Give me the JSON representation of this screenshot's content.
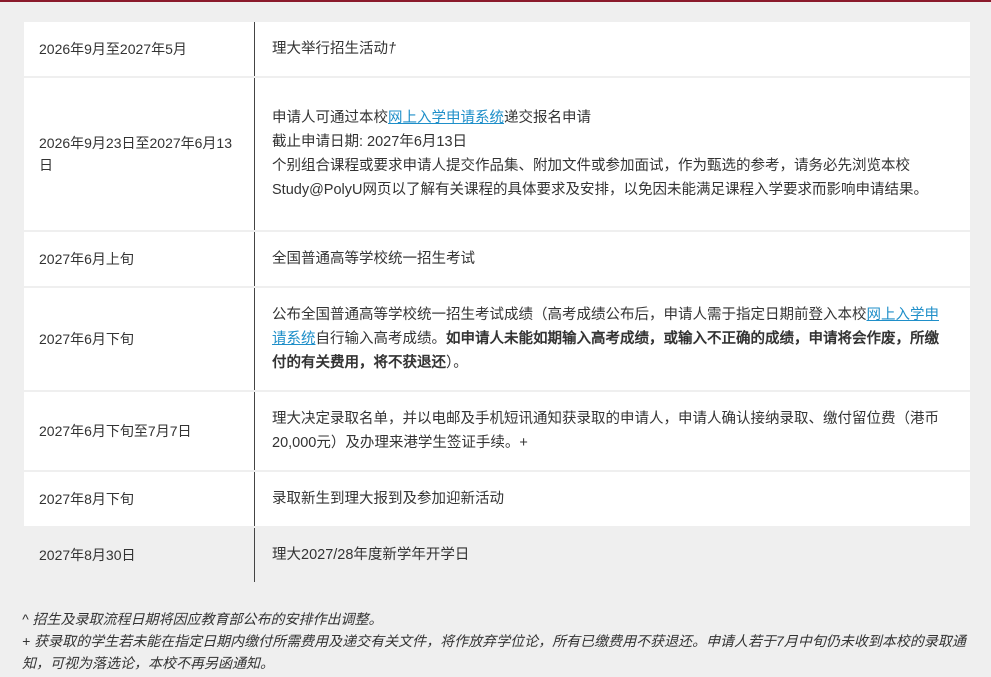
{
  "schedule": {
    "rows": [
      {
        "date": "2026年9月至2027年5月",
        "event": "理大举行招生活动",
        "marker": "†"
      },
      {
        "date": "2026年9月23日至2027年6月13日",
        "line1_pre": "申请人可通过本校",
        "line1_link": "网上入学申请系统",
        "line1_post": "递交报名申请",
        "line2": "截止申请日期: 2027年6月13日",
        "line3": "个别组合课程或要求申请人提交作品集、附加文件或参加面试，作为甄选的参考，请务必先浏览本校Study@PolyU网页以了解有关课程的具体要求及安排，以免因未能满足课程入学要求而影响申请结果。"
      },
      {
        "date": "2027年6月上旬",
        "event": "全国普通高等学校统一招生考试"
      },
      {
        "date": "2027年6月下旬",
        "pre": "公布全国普通高等学校统一招生考试成绩（高考成绩公布后，申请人需于指定日期前登入本校",
        "link": "网上入学申请系统",
        "mid": "自行输入高考成绩。",
        "bold": "如申请人未能如期输入高考成绩，或输入不正确的成绩，申请将会作废，所缴付的有关费用，将不获退还",
        "post": "）。"
      },
      {
        "date": "2027年6月下旬至7月7日",
        "event": "理大决定录取名单，并以电邮及手机短讯通知获录取的申请人，申请人确认接纳录取、缴付留位费（港币20,000元）及办理来港学生签证手续。+"
      },
      {
        "date": "2027年8月下旬",
        "event": "录取新生到理大报到及参加迎新活动"
      },
      {
        "date": "2027年8月30日",
        "event": "理大2027/28年度新学年开学日"
      }
    ]
  },
  "notes": {
    "note1": "^ 招生及录取流程日期将因应教育部公布的安排作出调整。",
    "note2": "+ 获录取的学生若未能在指定日期内缴付所需费用及递交有关文件，将作放弃学位论，所有已缴费用不获退还。申请人若于7月中旬仍未收到本校的录取通知，可视为落选论，本校不再另函通知。"
  }
}
